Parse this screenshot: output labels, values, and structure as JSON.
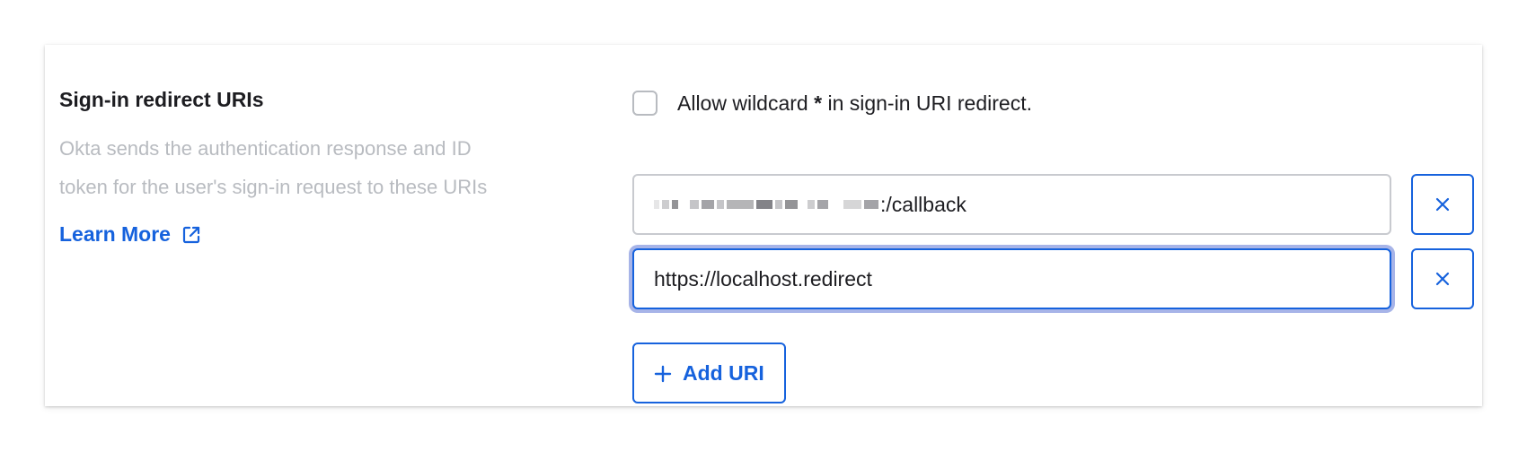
{
  "section": {
    "title": "Sign-in redirect URIs",
    "description_line1": "Okta sends the authentication response and ID",
    "description_line2": "token for the user's sign-in request to these URIs",
    "learn_more": "Learn More"
  },
  "wildcard": {
    "label_prefix": "Allow wildcard ",
    "label_star": "*",
    "label_suffix": " in sign-in URI redirect.",
    "checked": false
  },
  "uris": [
    {
      "value_visible_suffix": ":/callback",
      "masked": true
    },
    {
      "value": "https://localhost.redirect",
      "focused": true
    }
  ],
  "add_button": {
    "label": "Add URI"
  },
  "icons": {
    "external_link": "external-link-icon",
    "close": "close-icon",
    "plus": "plus-icon"
  },
  "colors": {
    "accent": "#1662dd",
    "focus_ring": "#a7b4e8",
    "muted_text": "#b8bbc0",
    "text": "#1d1d21"
  }
}
